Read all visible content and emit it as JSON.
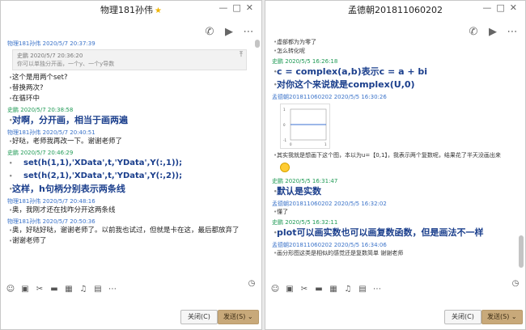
{
  "left": {
    "title": "物理181孙伟",
    "messages": [
      {
        "sender": "物理181孙伟",
        "time": "2020/5/7 20:37:39",
        "color": "blue",
        "quote": {
          "who": "史鹏",
          "time": "2020/5/7 20:36:20",
          "text": "你可以单独分开画，一个y、一个y导数"
        },
        "lines": [
          {
            "style": "txt",
            "text": "这个是用两个set?"
          },
          {
            "style": "txt",
            "text": "替换两次?"
          },
          {
            "style": "txt",
            "text": "在循环中"
          }
        ]
      },
      {
        "sender": "史鹏",
        "time": "2020/5/7 20:38:58",
        "color": "green",
        "lines": [
          {
            "style": "big",
            "text": "对啊，分开画，相当于画两遍"
          }
        ]
      },
      {
        "sender": "物理181孙伟",
        "time": "2020/5/7 20:40:51",
        "color": "blue",
        "lines": [
          {
            "style": "txt",
            "text": "好哒，老师我再改一下。谢谢老师了"
          }
        ]
      },
      {
        "sender": "史鹏",
        "time": "2020/5/7 20:46:29",
        "color": "green",
        "lines": [
          {
            "style": "code",
            "text": "set(h(1,1),'XData',t,'YData',Y(:,1));"
          },
          {
            "style": "code",
            "text": "set(h(2,1),'XData',t,'YData',Y(:,2));"
          },
          {
            "style": "big",
            "text": "这样，h句柄分别表示两条线"
          }
        ]
      },
      {
        "sender": "物理181孙伟",
        "time": "2020/5/7 20:48:16",
        "color": "blue",
        "lines": [
          {
            "style": "txt",
            "text": "奥，我刚才还在找咋分开这两条线"
          }
        ]
      },
      {
        "sender": "物理181孙伟",
        "time": "2020/5/7 20:50:36",
        "color": "blue",
        "lines": [
          {
            "style": "txt",
            "text": "奥，好哒好哒，谢谢老师了。以前我也试过，但就是卡在这，最后都放弃了"
          },
          {
            "style": "txt",
            "text": "谢谢老师了"
          }
        ]
      }
    ],
    "close_label": "关闭(C)",
    "send_label": "发送(S)"
  },
  "right": {
    "title": "孟德朝201811060202",
    "top_lines": [
      {
        "style": "small",
        "text": "虚部都为为零了"
      },
      {
        "style": "small",
        "text": "怎么转化呢"
      }
    ],
    "messages": [
      {
        "sender": "史鹏",
        "time": "2020/5/5 16:26:18",
        "color": "green",
        "lines": [
          {
            "style": "big",
            "text": "c = complex(a,b)表示c = a + bi"
          },
          {
            "style": "big",
            "text": "对你这个来说就是complex(U,0)"
          }
        ]
      },
      {
        "sender": "孟德朝201811060202",
        "time": "2020/5/5 16:30:26",
        "color": "blue",
        "has_image": true,
        "plot": {
          "ticks_y": [
            "1",
            "0",
            "-1"
          ],
          "ticks_x": [
            "0",
            "1"
          ]
        },
        "lines": [
          {
            "style": "small",
            "text": "其实我就是想画下这个图，本以为u=【0,1】，我表示两个复数呢，结果花了半天没画出来"
          }
        ],
        "emoji": true
      },
      {
        "sender": "史鹏",
        "time": "2020/5/5 16:31:47",
        "color": "green",
        "lines": [
          {
            "style": "big",
            "text": "默认是实数"
          }
        ]
      },
      {
        "sender": "孟德朝201811060202",
        "time": "2020/5/5 16:32:02",
        "color": "blue",
        "lines": [
          {
            "style": "small",
            "text": "懂了"
          }
        ]
      },
      {
        "sender": "史鹏",
        "time": "2020/5/5 16:32:11",
        "color": "green",
        "lines": [
          {
            "style": "big",
            "text": "plot可以画实数也可以画复数函数，但是画法不一样"
          }
        ]
      },
      {
        "sender": "孟德朝201811060202",
        "time": "2020/5/5 16:34:06",
        "color": "blue",
        "lines": [
          {
            "style": "small",
            "text": "画分形图这类是相似的感觉还是复数简单  谢谢老师"
          }
        ]
      }
    ],
    "close_label": "关闭(C)",
    "send_label": "发送(S)"
  }
}
